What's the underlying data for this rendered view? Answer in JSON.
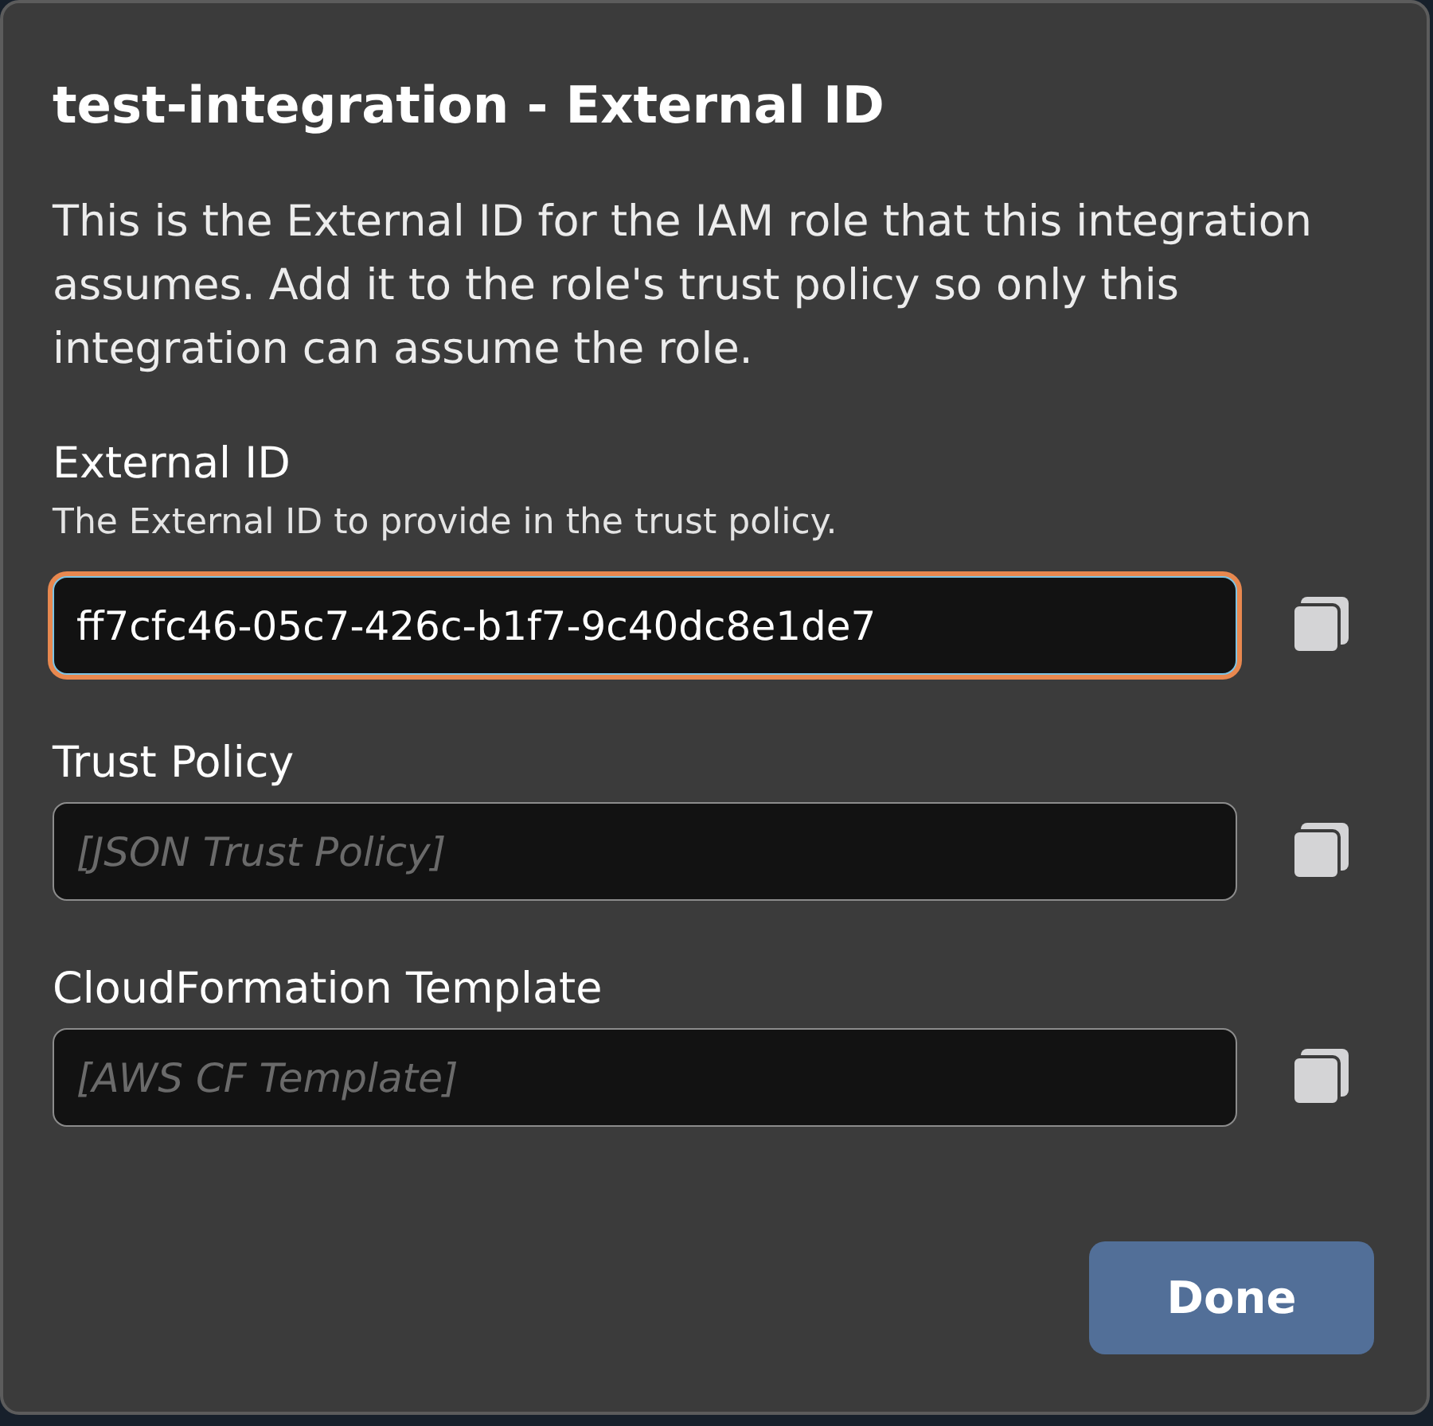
{
  "dialog": {
    "title": "test-integration - External ID",
    "description": "This is the External ID for the IAM role that this integration assumes. Add it to the role's trust policy so only this integration can assume the role.",
    "fields": [
      {
        "label": "External ID",
        "help": "The External ID to provide in the trust policy.",
        "value": "ff7cfc46-05c7-426c-b1f7-9c40dc8e1de7",
        "focused": true
      },
      {
        "label": "Trust Policy",
        "placeholder": "[JSON Trust Policy]",
        "focused": false
      },
      {
        "label": "CloudFormation Template",
        "placeholder": "[AWS CF Template]",
        "focused": false
      }
    ],
    "buttons": [
      {
        "label": "Done"
      }
    ]
  }
}
